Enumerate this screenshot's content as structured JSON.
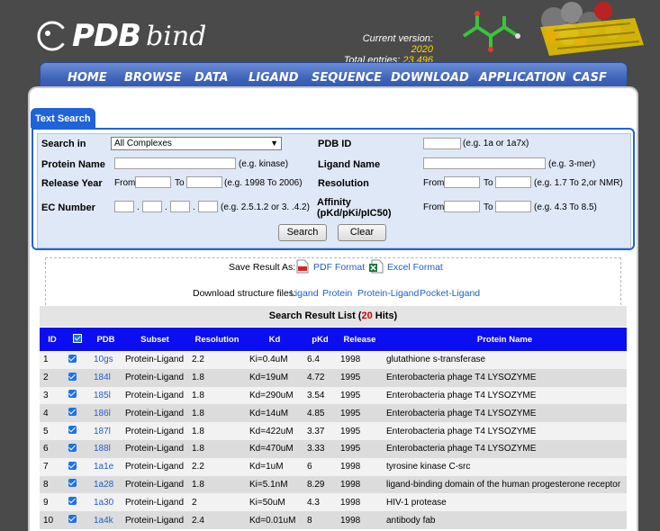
{
  "header": {
    "logo_pdb": "PDB",
    "logo_bind": "bind",
    "version_label": "Current version:",
    "version_value": "2020",
    "entries_label": "Total entries:",
    "entries_value": "23,496"
  },
  "nav": [
    "HOME",
    "BROWSE",
    "DATA",
    "LIGAND",
    "SEQUENCE",
    "DOWNLOAD",
    "APPLICATION",
    "CASF"
  ],
  "tab": "Text Search",
  "form": {
    "search_in_label": "Search in",
    "search_in_value": "All Complexes",
    "pdb_id_label": "PDB ID",
    "pdb_id_hint": "(e.g. 1a or 1a7x)",
    "protein_name_label": "Protein Name",
    "protein_name_hint": "(e.g. kinase)",
    "ligand_name_label": "Ligand Name",
    "ligand_name_hint": "(e.g. 3-mer)",
    "release_year_label": "Release Year",
    "from": "From",
    "to": "To",
    "release_hint": "(e.g. 1998 To 2006)",
    "resolution_label": "Resolution",
    "resolution_hint": "(e.g. 1.7 To 2,or NMR)",
    "ec_label": "EC Number",
    "ec_hint": "(e.g. 2.5.1.2 or 3. .4.2)",
    "affinity_label_1": "Affinity",
    "affinity_label_2": "(pKd/pKi/pIC50)",
    "affinity_hint": "(e.g. 4.3 To 8.5)",
    "search_button": "Search",
    "clear_button": "Clear"
  },
  "save": {
    "label": "Save Result As:",
    "pdf": "PDF Format",
    "excel": "Excel Format",
    "download_label": "Download structure files:",
    "links": [
      "Ligand",
      "Protein",
      "Protein-Ligand",
      "Pocket-Ligand"
    ]
  },
  "results": {
    "title_prefix": "Search Result List (",
    "hits_count": "20",
    "hits_suffix": " Hits)",
    "columns": [
      "ID",
      "",
      "PDB",
      "Subset",
      "Resolution",
      "Kd",
      "pKd",
      "Release",
      "Protein Name"
    ],
    "rows": [
      {
        "id": "1",
        "pdb": "10gs",
        "subset": "Protein-Ligand",
        "res": "2.2",
        "kd": "Ki=0.4uM",
        "pkd": "6.4",
        "release": "1998",
        "name": "glutathione s-transferase"
      },
      {
        "id": "2",
        "pdb": "184l",
        "subset": "Protein-Ligand",
        "res": "1.8",
        "kd": "Kd=19uM",
        "pkd": "4.72",
        "release": "1995",
        "name": "Enterobacteria phage T4 LYSOZYME"
      },
      {
        "id": "3",
        "pdb": "185l",
        "subset": "Protein-Ligand",
        "res": "1.8",
        "kd": "Kd=290uM",
        "pkd": "3.54",
        "release": "1995",
        "name": "Enterobacteria phage T4 LYSOZYME"
      },
      {
        "id": "4",
        "pdb": "186l",
        "subset": "Protein-Ligand",
        "res": "1.8",
        "kd": "Kd=14uM",
        "pkd": "4.85",
        "release": "1995",
        "name": "Enterobacteria phage T4 LYSOZYME"
      },
      {
        "id": "5",
        "pdb": "187l",
        "subset": "Protein-Ligand",
        "res": "1.8",
        "kd": "Kd=422uM",
        "pkd": "3.37",
        "release": "1995",
        "name": "Enterobacteria phage T4 LYSOZYME"
      },
      {
        "id": "6",
        "pdb": "188l",
        "subset": "Protein-Ligand",
        "res": "1.8",
        "kd": "Kd=470uM",
        "pkd": "3.33",
        "release": "1995",
        "name": "Enterobacteria phage T4 LYSOZYME"
      },
      {
        "id": "7",
        "pdb": "1a1e",
        "subset": "Protein-Ligand",
        "res": "2.2",
        "kd": "Kd=1uM",
        "pkd": "6",
        "release": "1998",
        "name": "tyrosine kinase C-src"
      },
      {
        "id": "8",
        "pdb": "1a28",
        "subset": "Protein-Ligand",
        "res": "1.8",
        "kd": "Ki=5.1nM",
        "pkd": "8.29",
        "release": "1998",
        "name": "ligand-binding domain of the human progesterone receptor"
      },
      {
        "id": "9",
        "pdb": "1a30",
        "subset": "Protein-Ligand",
        "res": "2",
        "kd": "Ki=50uM",
        "pkd": "4.3",
        "release": "1998",
        "name": "HIV-1 protease"
      },
      {
        "id": "10",
        "pdb": "1a4k",
        "subset": "Protein-Ligand",
        "res": "2.4",
        "kd": "Kd=0.01uM",
        "pkd": "8",
        "release": "1998",
        "name": "antibody fab"
      }
    ]
  },
  "colors": {
    "nav_blue": "#3c62b8",
    "table_header": "#0a0ef0",
    "tab_blue": "#1f63d8",
    "hits_red": "#d00000",
    "link_blue": "#1f5fc9",
    "version_yellow": "#ffd800"
  }
}
